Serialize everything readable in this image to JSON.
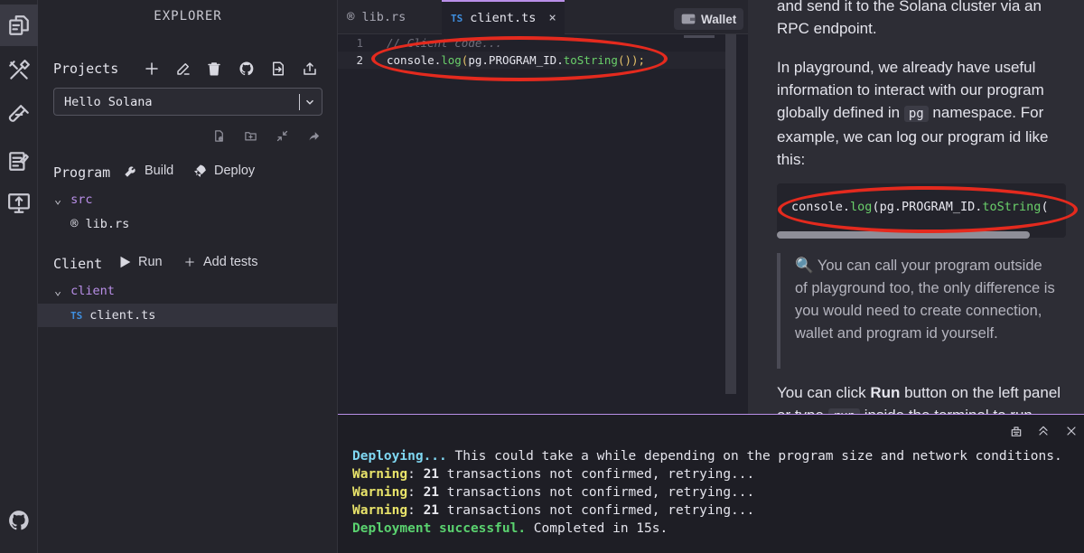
{
  "activity_bar": {
    "items": [
      {
        "icon": "explorer-files-icon",
        "active": true
      },
      {
        "icon": "build-tools-icon"
      },
      {
        "icon": "test-tube-icon"
      },
      {
        "icon": "tutorials-icon"
      },
      {
        "icon": "programs-monitor-icon"
      }
    ],
    "bottom_icon": "github-icon"
  },
  "explorer": {
    "title": "EXPLORER",
    "projects_label": "Projects",
    "project_toolbar_icons": [
      "add-icon",
      "rename-icon",
      "delete-icon",
      "github-icon",
      "import-icon",
      "export-icon"
    ],
    "selected_project": "Hello Solana",
    "file_toolbar_icons": [
      "new-file-icon",
      "new-folder-icon",
      "collapse-icon",
      "share-icon"
    ],
    "program_label": "Program",
    "build_label": "Build",
    "deploy_label": "Deploy",
    "program_tree": {
      "folder": "src",
      "file": "lib.rs"
    },
    "client_label": "Client",
    "run_label": "Run",
    "add_tests_label": "Add tests",
    "client_tree": {
      "folder": "client",
      "file": "client.ts",
      "file_badge": "TS"
    }
  },
  "editor": {
    "tabs": [
      {
        "label": "lib.rs",
        "badge": "rust-icon",
        "active": false
      },
      {
        "label": "client.ts",
        "badge": "TS",
        "active": true,
        "close": "×"
      }
    ],
    "wallet_label": "Wallet",
    "lines": [
      {
        "number": "1",
        "text": "// Client code..."
      },
      {
        "number": "2",
        "tokens": [
          "console",
          ".",
          "log",
          "(",
          "pg",
          ".",
          "PROGRAM_ID",
          ".",
          "toString",
          "());"
        ]
      }
    ]
  },
  "docs": {
    "para1": "and send it to the Solana cluster via an RPC endpoint.",
    "para2_before": "In playground, we already have useful information to interact with our program globally defined in ",
    "para2_code": "pg",
    "para2_after": " namespace. For example, we can log our program id like this:",
    "code_tokens": [
      "console",
      ".",
      "log",
      "(",
      "pg",
      ".",
      "PROGRAM_ID",
      ".",
      "toString",
      "("
    ],
    "tip": "🔍 You can call your program outside of playground too, the only difference is you would need to create connection, wallet and program id yourself.",
    "para3_before": "You can click ",
    "para3_bold": "Run",
    "para3_after": " button on the left panel or type ",
    "para3_code": "run",
    "para3_tail": " inside the terminal to run"
  },
  "terminal": {
    "toolbar_icons": [
      "clear-icon",
      "maximize-icon",
      "close-icon"
    ],
    "lines": [
      {
        "prefix": "Deploying...",
        "color": "#7fd7f2",
        "text": " This could take a while depending on the program size and network conditions."
      },
      {
        "prefix": "Warning",
        "color": "#e8e36a",
        "colon": ": ",
        "count": "21",
        "text": " transactions not confirmed, retrying..."
      },
      {
        "prefix": "Warning",
        "color": "#e8e36a",
        "colon": ": ",
        "count": "21",
        "text": " transactions not confirmed, retrying..."
      },
      {
        "prefix": "Warning",
        "color": "#e8e36a",
        "colon": ": ",
        "count": "21",
        "text": " transactions not confirmed, retrying..."
      },
      {
        "prefix": "Deployment successful.",
        "color": "#5ad26f",
        "text": " Completed in 15s."
      }
    ]
  },
  "colors": {
    "accent": "#b98fe8",
    "highlight": "#e42a1e",
    "ts_badge": "#3f8fe0"
  }
}
